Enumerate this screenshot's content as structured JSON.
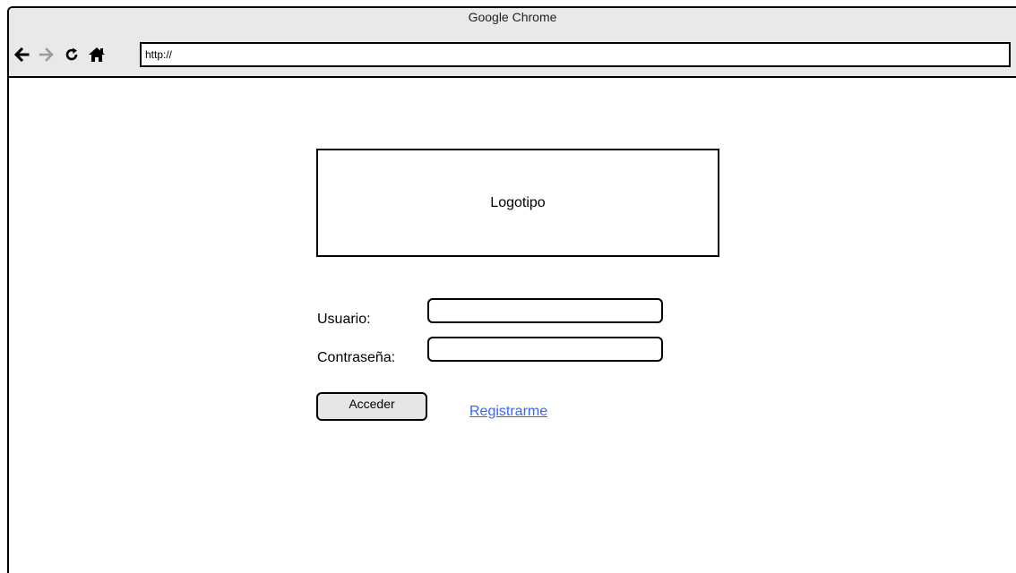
{
  "browser": {
    "title": "Google Chrome",
    "address": "http://",
    "icons": [
      "back-arrow-icon",
      "forward-arrow-icon",
      "reload-icon",
      "home-icon"
    ]
  },
  "page": {
    "logo_text": "Logotipo",
    "username_label": "Usuario:",
    "password_label": "Contraseña:",
    "username_value": "",
    "password_value": "",
    "login_button": "Acceder",
    "register_link": "Registrarme",
    "link_color": "#3366ff"
  }
}
